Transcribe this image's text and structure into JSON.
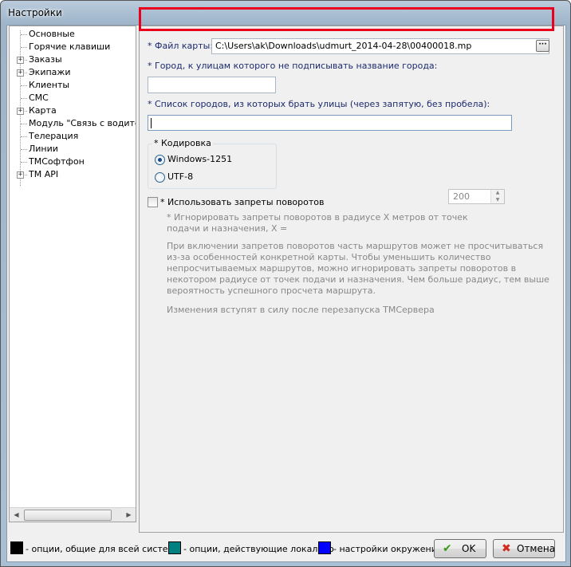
{
  "window": {
    "title": "Настройки"
  },
  "tree": {
    "items": [
      {
        "label": "Основные",
        "expandable": false
      },
      {
        "label": "Горячие клавиши",
        "expandable": false
      },
      {
        "label": "Заказы",
        "expandable": true
      },
      {
        "label": "Экипажи",
        "expandable": true
      },
      {
        "label": "Клиенты",
        "expandable": false
      },
      {
        "label": "СМС",
        "expandable": false
      },
      {
        "label": "Карта",
        "expandable": true
      },
      {
        "label": "Модуль \"Связь с водителем\"",
        "expandable": false
      },
      {
        "label": "Телерация",
        "expandable": false
      },
      {
        "label": "Линии",
        "expandable": false
      },
      {
        "label": "ТМСофтфон",
        "expandable": false
      },
      {
        "label": "TM API",
        "expandable": true
      }
    ],
    "expander_glyph": "+"
  },
  "map_settings": {
    "map_file_label": "* Файл карты:",
    "map_file_value": "C:\\Users\\ak\\Downloads\\udmurt_2014-04-28\\00400018.mp",
    "browse_label": "···",
    "city_label": "* Город, к улицам которого не подписывать название города:",
    "city_value": "",
    "cities_list_label": "* Список городов, из которых брать улицы (через запятую, без пробела):",
    "cities_list_value": "",
    "encoding": {
      "title": "* Кодировка",
      "options": [
        "Windows-1251",
        "UTF-8"
      ],
      "selected": "Windows-1251"
    },
    "turn_restrictions": {
      "checkbox_label": "* Использовать запреты поворотов",
      "checked": false,
      "ignore_radius_label_line1": "* Игнорировать запреты поворотов в радиусе X метров от точек",
      "ignore_radius_label_line2": "подачи  и назначения, X =",
      "radius_value": "200",
      "note_lines": [
        "При включении запретов поворотов часть маршрутов может не просчитываться",
        "из-за особенностей конкретной карты. Чтобы уменьшить количество",
        "непросчитываемых маршрутов, можно игнорировать запреты поворотов в",
        "некотором радиусе от точек подачи и назначения. Чем больше радиус, тем выше",
        "вероятность успешного просчета маршрута."
      ],
      "restart_note": "Изменения вступят в силу после перезапуска ТМСервера"
    }
  },
  "legend": [
    {
      "color": "#000000",
      "label": "- опции, общие для всей системы"
    },
    {
      "color": "#008080",
      "label": "- опции, действующие локально"
    },
    {
      "color": "#0000ff",
      "label": "- настройки окружения"
    }
  ],
  "buttons": {
    "ok_label": "OK",
    "ok_icon": "check-icon",
    "cancel_label": "Отмена",
    "cancel_icon": "cross-icon"
  },
  "colors": {
    "highlight_border": "#e8001c",
    "label_navy": "#1c2a6c",
    "disabled_text": "#888888"
  }
}
